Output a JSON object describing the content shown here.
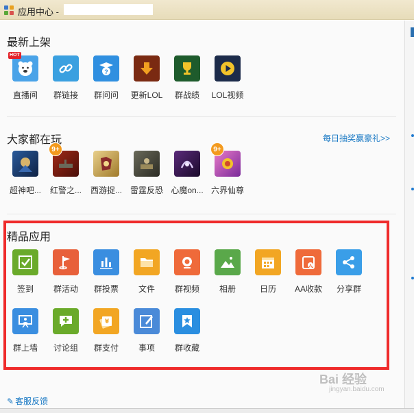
{
  "window": {
    "title": "应用中心 -"
  },
  "sections": {
    "new": {
      "title": "最新上架",
      "apps": [
        {
          "label": "直播间",
          "icon": "bear-icon",
          "color": "#4aa3e8",
          "badge": "HOT"
        },
        {
          "label": "群链接",
          "icon": "link-icon",
          "color": "#3aa0e0"
        },
        {
          "label": "群问问",
          "icon": "question-icon",
          "color": "#2f8fe0"
        },
        {
          "label": "更新LOL",
          "icon": "download-arrow-icon",
          "color": "#7a2a12"
        },
        {
          "label": "群战绩",
          "icon": "trophy-icon",
          "color": "#1e5b2c"
        },
        {
          "label": "LOL视频",
          "icon": "play-icon",
          "color": "#1c2b4a"
        }
      ]
    },
    "popular": {
      "title": "大家都在玩",
      "promo_link": "每日抽奖赢豪礼>>",
      "apps": [
        {
          "label": "超神吧...",
          "icon": "game-icon",
          "color": "#1d3a6a"
        },
        {
          "label": "红警之...",
          "icon": "game-icon",
          "color": "#7a1b12",
          "badge": "9+"
        },
        {
          "label": "西游捉...",
          "icon": "game-icon",
          "color": "#c9a24a"
        },
        {
          "label": "雷霆反恐",
          "icon": "game-icon",
          "color": "#4a4a3a"
        },
        {
          "label": "心魔on...",
          "icon": "game-icon",
          "color": "#3a1a4a"
        },
        {
          "label": "六界仙尊",
          "icon": "game-icon",
          "color": "#d05aa8",
          "badge": "9+"
        }
      ]
    },
    "featured": {
      "title": "精品应用",
      "apps": [
        {
          "label": "签到",
          "icon": "checkbox-icon",
          "color": "#6aaa2a"
        },
        {
          "label": "群活动",
          "icon": "flag-icon",
          "color": "#e8603a"
        },
        {
          "label": "群投票",
          "icon": "bar-chart-icon",
          "color": "#3a8ee0"
        },
        {
          "label": "文件",
          "icon": "folder-icon",
          "color": "#f2a623"
        },
        {
          "label": "群视频",
          "icon": "camera-icon",
          "color": "#ef6a3a"
        },
        {
          "label": "相册",
          "icon": "image-icon",
          "color": "#5aa84a"
        },
        {
          "label": "日历",
          "icon": "calendar-icon",
          "color": "#f2a623"
        },
        {
          "label": "AA收款",
          "icon": "wallet-icon",
          "color": "#ef6a3a"
        },
        {
          "label": "分享群",
          "icon": "share-icon",
          "color": "#3a9ee8"
        },
        {
          "label": "群上墙",
          "icon": "presentation-icon",
          "color": "#3a8ee0"
        },
        {
          "label": "讨论组",
          "icon": "chat-plus-icon",
          "color": "#6aaa2a"
        },
        {
          "label": "群支付",
          "icon": "money-icon",
          "color": "#f2a623"
        },
        {
          "label": "事项",
          "icon": "edit-icon",
          "color": "#4a8ad8"
        },
        {
          "label": "群收藏",
          "icon": "bookmark-star-icon",
          "color": "#2a8ee0"
        }
      ]
    }
  },
  "footer": {
    "feedback": "客服反馈"
  },
  "watermark": {
    "brand": "Bai 经验",
    "url": "jingyan.baidu.com"
  },
  "colors": {
    "highlight": "#ef2b2b",
    "link": "#1a79c4"
  }
}
